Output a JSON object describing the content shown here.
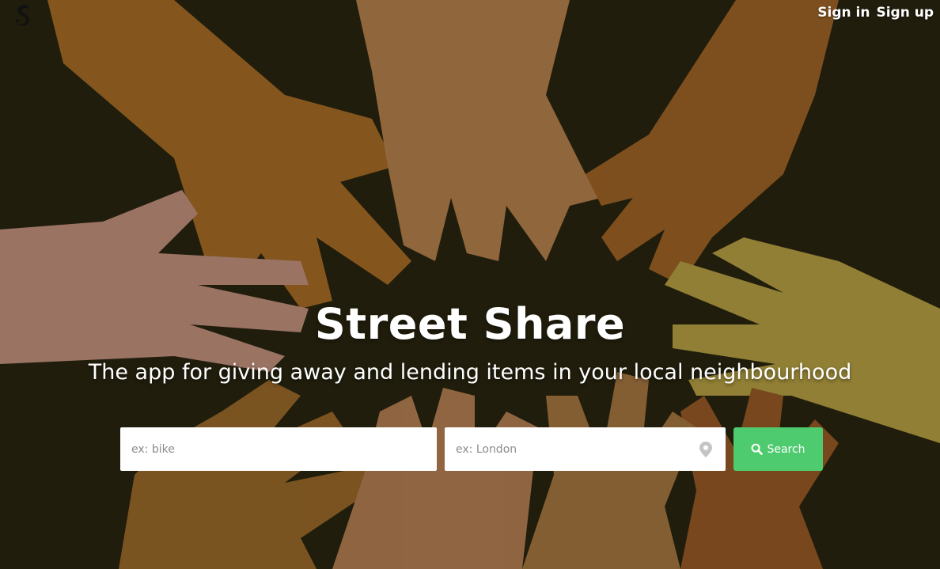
{
  "nav": {
    "sign_in": "Sign in",
    "sign_up": "Sign up"
  },
  "hero": {
    "title": "Street Share",
    "subtitle": "The app for giving away and lending items in your local neighbourhood"
  },
  "search": {
    "item_placeholder": "ex: bike",
    "location_placeholder": "ex: London",
    "button_label": "Search"
  },
  "colors": {
    "button": "#4ecb6f",
    "text": "#ffffff"
  },
  "icons": {
    "logo": "squirrel-logo-icon",
    "location": "map-pin-icon",
    "search": "magnifier-icon"
  }
}
